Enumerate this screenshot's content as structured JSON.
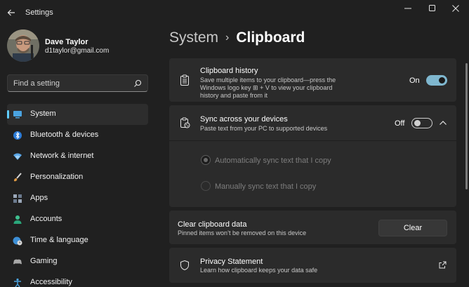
{
  "window": {
    "title": "Settings",
    "controls": [
      "minimize-icon",
      "maximize-icon",
      "close-icon"
    ]
  },
  "profile": {
    "name": "Dave Taylor",
    "email": "d1taylor@gmail.com"
  },
  "search": {
    "placeholder": "Find a setting"
  },
  "sidebar": {
    "items": [
      {
        "label": "System",
        "icon": "system-icon",
        "active": true
      },
      {
        "label": "Bluetooth & devices",
        "icon": "bluetooth-icon"
      },
      {
        "label": "Network & internet",
        "icon": "wifi-icon"
      },
      {
        "label": "Personalization",
        "icon": "brush-icon"
      },
      {
        "label": "Apps",
        "icon": "apps-icon"
      },
      {
        "label": "Accounts",
        "icon": "person-icon"
      },
      {
        "label": "Time & language",
        "icon": "globe-clock-icon"
      },
      {
        "label": "Gaming",
        "icon": "gamepad-icon"
      },
      {
        "label": "Accessibility",
        "icon": "accessibility-icon"
      }
    ]
  },
  "breadcrumb": {
    "parent": "System",
    "separator": "›",
    "current": "Clipboard"
  },
  "clipboard_history": {
    "title": "Clipboard history",
    "description_line1": "Save multiple items to your clipboard—press the",
    "description_line2": "Windows logo key ⊞ + V to view your clipboard",
    "description_line3": "history and paste from it",
    "state_label": "On",
    "enabled": true
  },
  "sync": {
    "title": "Sync across your devices",
    "description": "Paste text from your PC to supported devices",
    "state_label": "Off",
    "enabled": false,
    "options": [
      {
        "label": "Automatically sync text that I copy",
        "selected": true
      },
      {
        "label": "Manually sync text that I copy",
        "selected": false
      }
    ]
  },
  "clear_data": {
    "title": "Clear clipboard data",
    "description": "Pinned items won’t be removed on this device",
    "button_label": "Clear"
  },
  "privacy": {
    "title": "Privacy Statement",
    "description": "Learn how clipboard keeps your data safe"
  },
  "colors": {
    "accent": "#60cdff",
    "toggle_on": "#7fb7cf",
    "background": "#202020",
    "card": "#2b2b2b"
  }
}
